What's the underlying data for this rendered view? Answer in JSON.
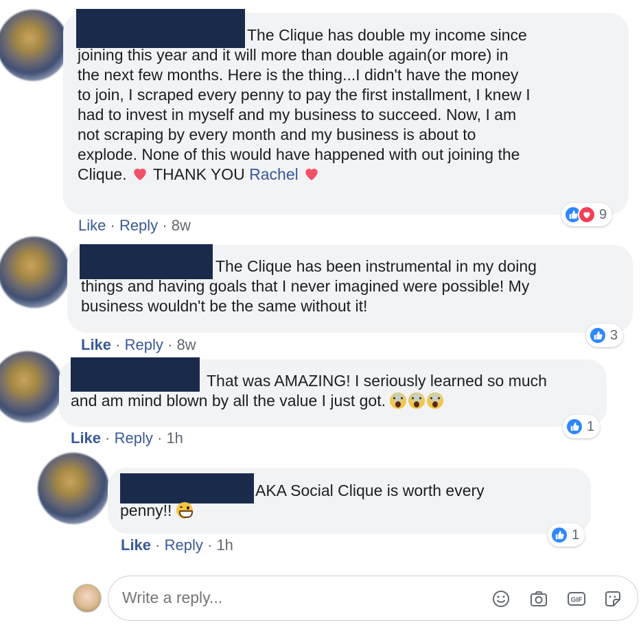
{
  "comments": [
    {
      "text_lines": [
        "The Clique has double my income since",
        "joining this year and it will more than double again(or more) in",
        "the next few months. Here is the thing...I didn't have the money",
        "to join, I scraped every penny to pay the first installment, I knew I",
        "had to invest in myself and my business to succeed. Now, I am",
        "not scraping by every month and my business is about to",
        "explode. None of this would have happened with out joining the"
      ],
      "last_line_start": "Clique.",
      "last_line_mid": "THANK YOU",
      "mention": "Rachel",
      "reaction_count": "9",
      "like": "Like",
      "reply": "Reply",
      "time": "8w"
    },
    {
      "text_lines": [
        "The Clique has been instrumental in my doing",
        "things and having goals that I never imagined were possible! My",
        "business wouldn't be the same without it!"
      ],
      "reaction_count": "3",
      "like": "Like",
      "reply": "Reply",
      "time": "8w"
    },
    {
      "text_lines": [
        "That was AMAZING! I seriously learned so much",
        "and am mind blown by all the value I just got."
      ],
      "reaction_count": "1",
      "like": "Like",
      "reply": "Reply",
      "time": "1h"
    },
    {
      "text_lines": [
        "AKA Social Clique is worth every",
        "penny!!"
      ],
      "reaction_count": "1",
      "like": "Like",
      "reply": "Reply",
      "time": "1h"
    }
  ],
  "composer": {
    "placeholder": "Write a reply..."
  },
  "colors": {
    "link": "#385898",
    "bubble": "#f2f3f5",
    "like_blue": "#2d88ff",
    "love_red": "#f33e58",
    "redaction": "#1a2a4a"
  },
  "icons": [
    "like-reaction-icon",
    "love-reaction-icon",
    "heart-emoji-icon",
    "scream-emoji-icon",
    "grin-emoji-icon",
    "emoji-icon",
    "camera-icon",
    "gif-icon",
    "sticker-icon"
  ]
}
